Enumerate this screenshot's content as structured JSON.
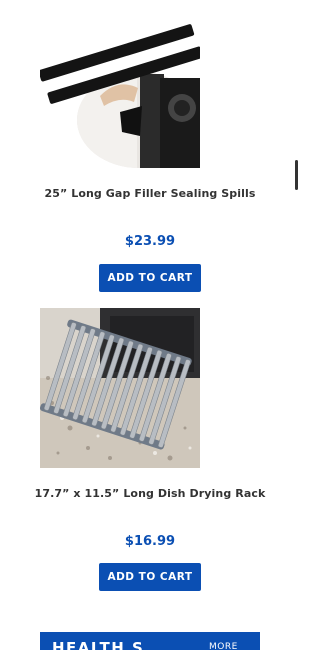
{
  "products": [
    {
      "title": "25” Long Gap Filler Sealing Spills",
      "price": "$23.99",
      "button_label": "ADD TO CART",
      "image_icon": "gap-filler-strips-image"
    },
    {
      "title": "17.7” x 11.5” Long Dish Drying Rack",
      "price": "$16.99",
      "button_label": "ADD TO CART",
      "image_icon": "dish-drying-rack-image"
    }
  ],
  "banner": {
    "title": "HEALTH S",
    "more_label": "MORE"
  },
  "colors": {
    "accent": "#0b4fb3",
    "title_text": "#333333",
    "background": "#ffffff"
  }
}
